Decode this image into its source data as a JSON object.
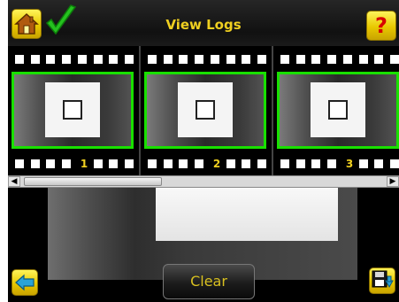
{
  "header": {
    "title": "View Logs",
    "home_icon": "home-icon",
    "status_icon": "pass-check-icon",
    "help_label": "?"
  },
  "filmstrip": {
    "frames": [
      {
        "number": "1"
      },
      {
        "number": "2"
      },
      {
        "number": "3"
      }
    ]
  },
  "footer": {
    "clear_label": "Clear",
    "back_icon": "back-arrow-icon",
    "save_icon": "save-disk-icon"
  },
  "colors": {
    "accent_yellow": "#f0d020",
    "frame_border": "#19e000",
    "help_red": "#d80000"
  }
}
